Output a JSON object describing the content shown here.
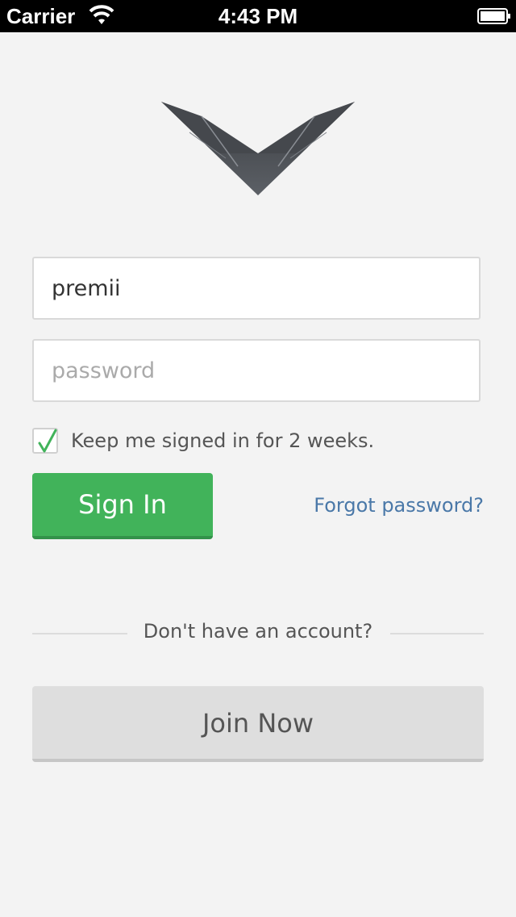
{
  "status_bar": {
    "carrier": "Carrier",
    "time": "4:43 PM",
    "wifi_icon": "wifi-icon",
    "battery_icon": "battery-icon"
  },
  "logo": {
    "icon": "wings-v-logo"
  },
  "login_form": {
    "username_value": "premii",
    "password_placeholder": "password",
    "keep_signed_in_checked": true,
    "keep_signed_in_label": "Keep me signed in for 2 weeks.",
    "sign_in_label": "Sign In",
    "forgot_password_label": "Forgot password?"
  },
  "signup": {
    "prompt": "Don't have an account?",
    "join_label": "Join Now"
  },
  "colors": {
    "accent_green": "#41b35a",
    "link_blue": "#4a78a8",
    "background": "#f3f3f3"
  }
}
